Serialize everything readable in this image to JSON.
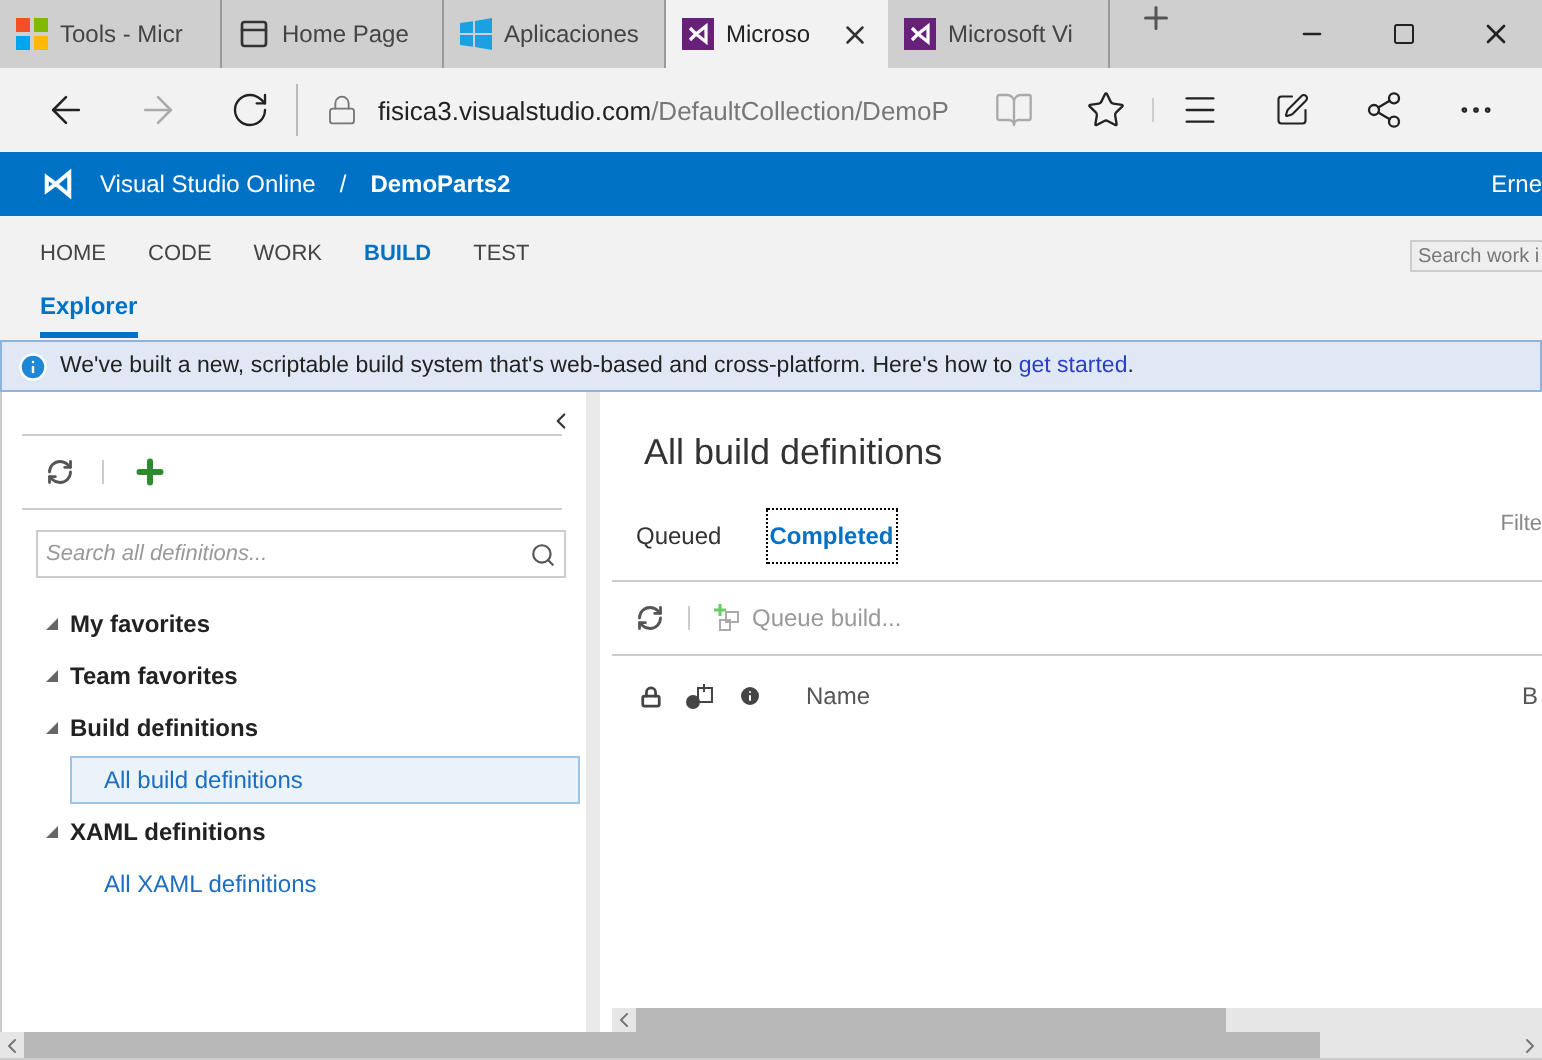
{
  "browser_tabs": [
    {
      "kind": "tools",
      "title": "Tools - Micr",
      "selected": false
    },
    {
      "kind": "page",
      "title": "Home Page",
      "selected": false
    },
    {
      "kind": "store",
      "title": "Aplicaciones",
      "selected": false
    },
    {
      "kind": "vs",
      "title": "Microso",
      "selected": true
    },
    {
      "kind": "vs",
      "title": "Microsoft Vi",
      "selected": false
    }
  ],
  "address": {
    "host": "fisica3.visualstudio.com",
    "path": "/DefaultCollection/DemoP"
  },
  "header": {
    "product": "Visual Studio Online",
    "separator": "/",
    "project": "DemoParts2",
    "user": "Erne"
  },
  "hubs": [
    {
      "label": "HOME",
      "selected": false
    },
    {
      "label": "CODE",
      "selected": false
    },
    {
      "label": "WORK",
      "selected": false
    },
    {
      "label": "BUILD",
      "selected": true
    },
    {
      "label": "TEST",
      "selected": false
    }
  ],
  "search_work": {
    "placeholder": "Search work i"
  },
  "pivots": [
    {
      "label": "Explorer",
      "selected": true
    }
  ],
  "banner": {
    "text": "We've built a new, scriptable build system that's web-based and cross-platform. Here's how to ",
    "link": "get started",
    "end": "."
  },
  "sidebar": {
    "search": {
      "placeholder": "Search all definitions..."
    },
    "tree": [
      {
        "label": "My favorites",
        "expanded": true
      },
      {
        "label": "Team favorites",
        "expanded": true
      },
      {
        "label": "Build definitions",
        "expanded": true,
        "children": [
          {
            "label": "All build definitions",
            "selected": true
          }
        ]
      },
      {
        "label": "XAML definitions",
        "expanded": true,
        "children": [
          {
            "label": "All XAML definitions",
            "selected": false
          }
        ]
      }
    ]
  },
  "main": {
    "title": "All build definitions",
    "tabs": [
      {
        "label": "Queued",
        "selected": false
      },
      {
        "label": "Completed",
        "selected": true
      }
    ],
    "filter": "Filte",
    "queue_button": "Queue build...",
    "columns": [
      "Name",
      "B"
    ]
  }
}
